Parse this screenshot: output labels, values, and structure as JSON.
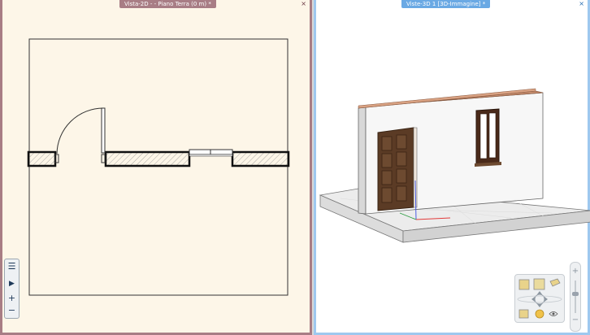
{
  "view2d": {
    "title": "Vista-2D - - Piano Terra (0 m) *",
    "close": "×",
    "toolbar": {
      "list": "☰",
      "play": "▶",
      "zoom_in": "+",
      "zoom_out": "−"
    }
  },
  "view3d": {
    "title": "Viste-3D 1 [3D-Immagine] *",
    "close": "×",
    "zoom": {
      "plus": "+",
      "minus": "−"
    }
  },
  "colors": {
    "pane2d_bg": "#fdf6e8",
    "pane2d_border": "#a87d85",
    "pane3d_border": "#9ec8ef",
    "wall_top": "#c98f70",
    "door_wood": "#5b3b25",
    "axis_x": "#e23b3b",
    "axis_y": "#2f9e44",
    "axis_z": "#3b4fe2"
  },
  "icons": [
    "list-icon",
    "play-icon",
    "zoom-in-icon",
    "zoom-out-icon",
    "close-icon",
    "nav-cube-icon",
    "orbit-icon",
    "pan-arrows-icon",
    "eye-icon",
    "sun-icon"
  ]
}
